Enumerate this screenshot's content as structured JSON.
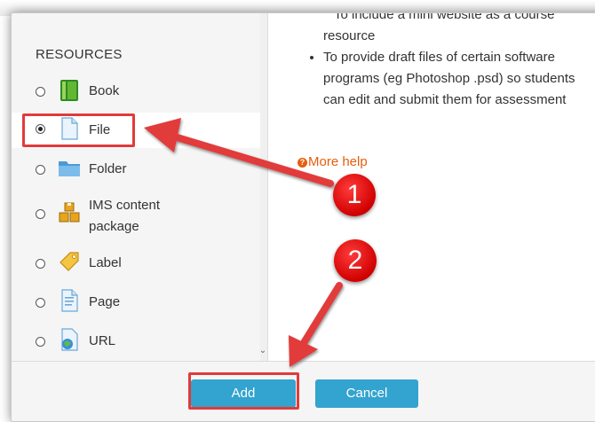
{
  "sections": {
    "resources_heading": "RESOURCES"
  },
  "modules": [
    {
      "label": "Book",
      "icon": "book-icon",
      "selected": false
    },
    {
      "label": "File",
      "icon": "file-icon",
      "selected": true
    },
    {
      "label": "Folder",
      "icon": "folder-icon",
      "selected": false
    },
    {
      "label_line1": "IMS content",
      "label_line2": "package",
      "icon": "ims-package-icon",
      "selected": false
    },
    {
      "label": "Label",
      "icon": "label-icon",
      "selected": false
    },
    {
      "label": "Page",
      "icon": "page-icon",
      "selected": false
    },
    {
      "label": "URL",
      "icon": "url-icon",
      "selected": false
    }
  ],
  "help": {
    "clipped_text": "To include a mini website as a course",
    "line_resource": "resource",
    "bullets": [
      "To provide draft files of certain software programs (eg Photoshop .psd) so students can edit and submit them for assessment"
    ],
    "more_help": "More help"
  },
  "footer": {
    "add_label": "Add",
    "cancel_label": "Cancel"
  },
  "annotations": {
    "step1": "1",
    "step2": "2",
    "color": "#e23a3a"
  },
  "colors": {
    "button": "#33a3cf",
    "help_link": "#e85d0c"
  }
}
